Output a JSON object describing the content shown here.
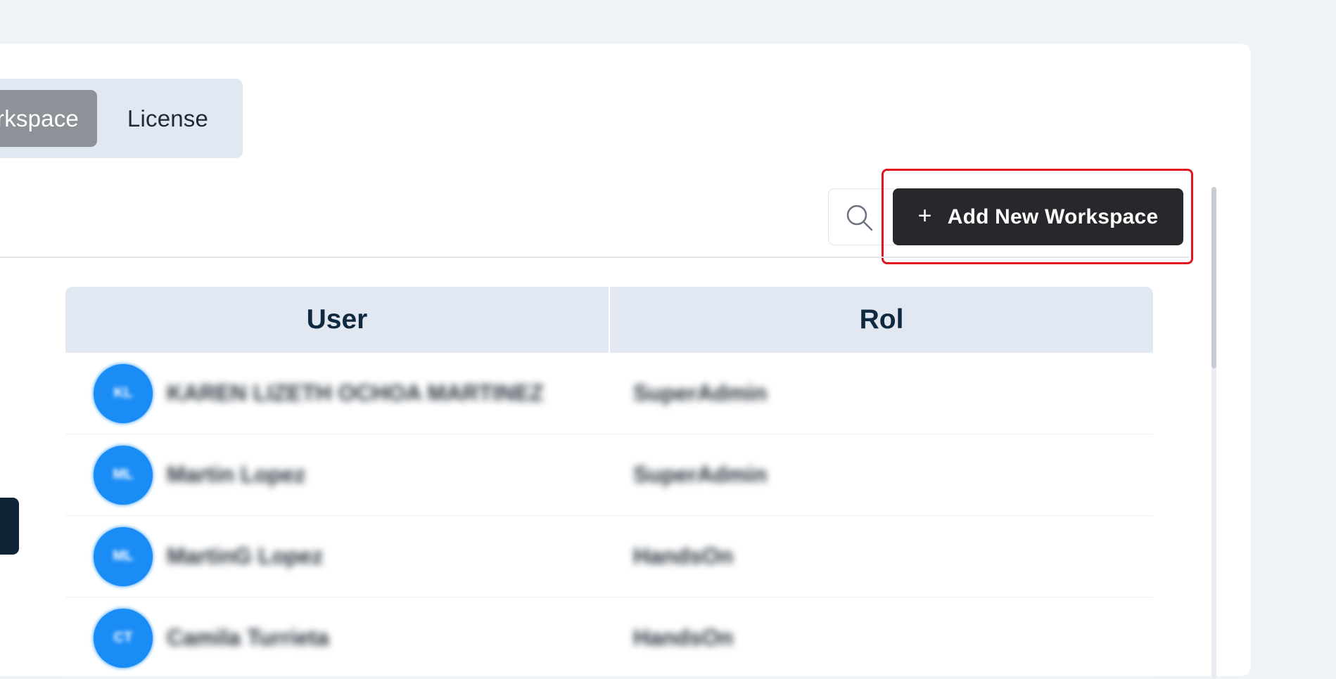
{
  "tabs": {
    "workspace_label": "Workspace",
    "license_label": "License"
  },
  "toolbar": {
    "search_icon": "search-icon",
    "add_plus": "+",
    "add_label": "Add New Workspace"
  },
  "table": {
    "columns": [
      "User",
      "Rol"
    ],
    "rows": [
      {
        "initials": "KL",
        "name": "KAREN LIZETH OCHOA MARTINEZ",
        "role": "SuperAdmin"
      },
      {
        "initials": "ML",
        "name": "Martin Lopez",
        "role": "SuperAdmin"
      },
      {
        "initials": "ML",
        "name": "MartinG Lopez",
        "role": "HandsOn"
      },
      {
        "initials": "CT",
        "name": "Camila Turrieta",
        "role": "HandsOn"
      }
    ]
  },
  "colors": {
    "accent_dark": "#27282c",
    "avatar": "#1a8cf5",
    "highlight": "#e0141c"
  }
}
